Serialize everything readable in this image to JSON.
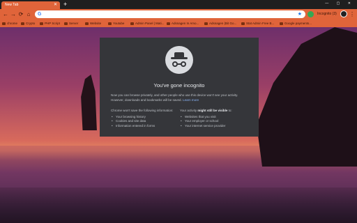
{
  "tab": {
    "title": "New Tab",
    "close": "✕"
  },
  "newtab": "+",
  "window_controls": "— ▢ ✕",
  "nav": {
    "back": "←",
    "forward": "→",
    "reload": "⟳",
    "home": "⌂"
  },
  "omnibox": {
    "g_letter": "G",
    "value": "",
    "placeholder": ""
  },
  "profile": {
    "label": "Incognito (3)"
  },
  "bookmarks": [
    {
      "label": "chrome"
    },
    {
      "label": "Crypto"
    },
    {
      "label": "PHP Script"
    },
    {
      "label": "Server"
    },
    {
      "label": "Website"
    },
    {
      "label": "Youtube"
    },
    {
      "label": "Admin Panel | Mati..."
    },
    {
      "label": "Adsnagen In Amo..."
    },
    {
      "label": "Adsnagen (Bit Go..."
    },
    {
      "label": "Stat Admin Free B..."
    },
    {
      "label": "Google payments..."
    }
  ],
  "panel": {
    "title": "You've gone incognito",
    "desc": "Now you can browse privately, and other people who use this device won't see your activity. However, downloads and bookmarks will be saved.",
    "learn_more": "Learn more",
    "left_head": "Chrome won't save the following information:",
    "left_items": [
      "Your browsing history",
      "Cookies and site data",
      "Information entered in forms"
    ],
    "right_head_pre": "Your activity ",
    "right_head_bold": "might still be visible",
    "right_head_post": " to:",
    "right_items": [
      "Websites that you visit",
      "Your employer or school",
      "Your internet service provider"
    ]
  }
}
